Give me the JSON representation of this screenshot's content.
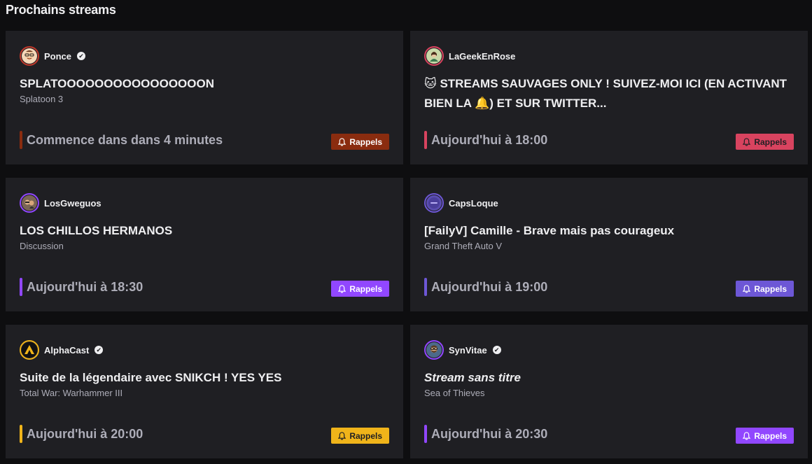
{
  "page": {
    "heading": "Prochains streams"
  },
  "cards": [
    {
      "streamer": "Ponce",
      "verified": true,
      "title": "SPLATOOOOOOOOOOOOOOOON",
      "game": "Splatoon 3",
      "time": "Commence dans dans 4 minutes",
      "accent": "#8a2c0f",
      "button_label": "Rappels",
      "button_bg": "#8a2c0f",
      "button_fg": "#ffffff",
      "avatar_icon": "person-glasses-avatar",
      "avatar_color": "#c0392b"
    },
    {
      "streamer": "LaGeekEnRose",
      "verified": false,
      "title": "🐱 STREAMS SAUVAGES ONLY ! SUIVEZ-MOI ICI (EN ACTIVANT BIEN LA 🔔) ET SUR TWITTER...",
      "game": "",
      "time": "Aujourd'hui à 18:00",
      "accent": "#d8435f",
      "button_label": "Rappels",
      "button_bg": "#d8435f",
      "button_fg": "#1f1f23",
      "avatar_icon": "person-avatar",
      "avatar_color": "#b0c48a"
    },
    {
      "streamer": "LosGweguos",
      "verified": false,
      "title": "LOS CHILLOS HERMANOS",
      "game": "Discussion",
      "time": "Aujourd'hui à 18:30",
      "accent": "#9147ff",
      "button_label": "Rappels",
      "button_bg": "#9147ff",
      "button_fg": "#ffffff",
      "avatar_icon": "duo-avatar",
      "avatar_color": "#6d5a4f"
    },
    {
      "streamer": "CapsLoque",
      "verified": false,
      "title": "[FailyV] Camille - Brave mais pas courageux",
      "game": "Grand Theft Auto V",
      "time": "Aujourd'hui à 19:00",
      "accent": "#6d57d6",
      "button_label": "Rappels",
      "button_bg": "#6d57d6",
      "button_fg": "#ffffff",
      "avatar_icon": "logo-avatar",
      "avatar_color": "#5a4db0"
    },
    {
      "streamer": "AlphaCast",
      "verified": true,
      "title": "Suite de la légendaire avec SNIKCH ! YES YES",
      "game": "Total War: Warhammer III",
      "time": "Aujourd'hui à 20:00",
      "accent": "#f0b41a",
      "button_label": "Rappels",
      "button_bg": "#f0b41a",
      "button_fg": "#1f1f23",
      "avatar_icon": "triangle-logo-avatar",
      "avatar_color": "#111111"
    },
    {
      "streamer": "SynVitae",
      "verified": true,
      "title": "Stream sans titre",
      "game": "Sea of Thieves",
      "title_italic": true,
      "time": "Aujourd'hui à 20:30",
      "accent": "#9147ff",
      "button_label": "Rappels",
      "button_bg": "#9147ff",
      "button_fg": "#ffffff",
      "avatar_icon": "person-beard-avatar",
      "avatar_color": "#4c6a8a"
    }
  ]
}
